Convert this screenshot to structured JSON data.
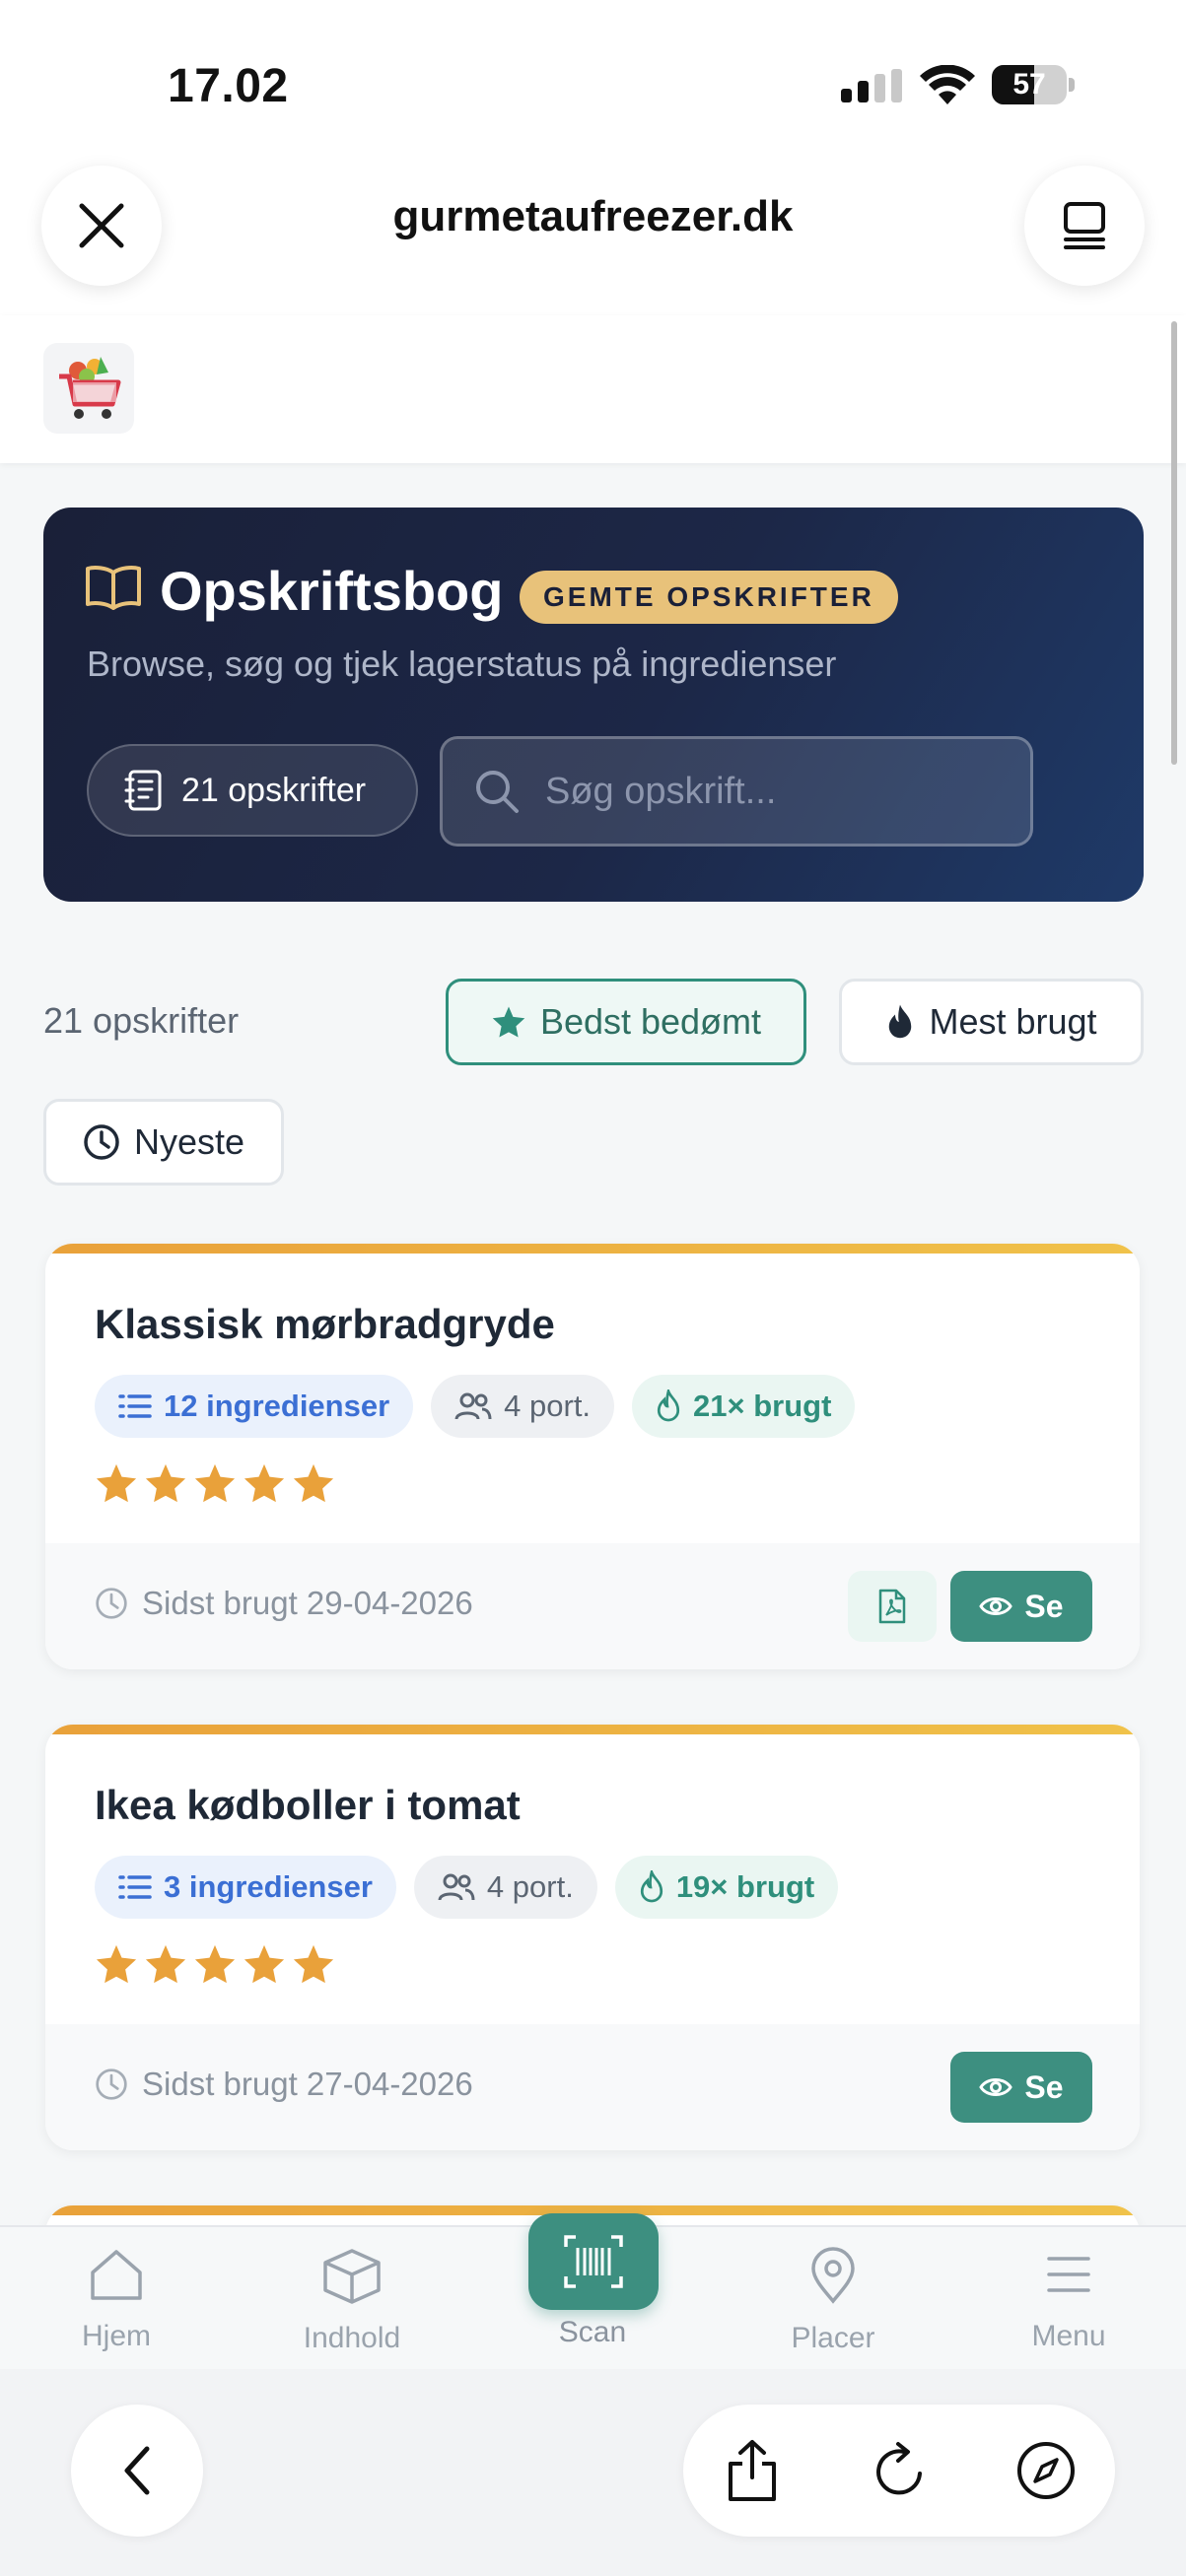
{
  "status_bar": {
    "time": "17.02",
    "battery": "57",
    "battery_level": 0.57
  },
  "browser": {
    "domain": "gurmetaufreezer.dk"
  },
  "hero": {
    "title": "Opskriftsbog",
    "badge": "GEMTE OPSKRIFTER",
    "subtitle": "Browse, søg og tjek lagerstatus på ingredienser",
    "count_label": "21 opskrifter",
    "search_placeholder": "Søg opskrift..."
  },
  "list": {
    "result_count": "21 opskrifter",
    "sort_options": [
      "Bedst bedømt",
      "Mest brugt",
      "Nyeste"
    ],
    "active_sort": "Bedst bedømt"
  },
  "recipes": [
    {
      "title": "Klassisk mørbradgryde",
      "ingredients": "12 ingredienser",
      "portions": "4 port.",
      "used": "21× brugt",
      "rating": 5,
      "last_used": "Sidst brugt 29-04-2026",
      "has_pdf": true,
      "view_label": "Se"
    },
    {
      "title": "Ikea kødboller i tomat",
      "ingredients": "3 ingredienser",
      "portions": "4 port.",
      "used": "19× brugt",
      "rating": 5,
      "last_used": "Sidst brugt 27-04-2026",
      "has_pdf": false,
      "view_label": "Se"
    }
  ],
  "app_nav": {
    "items": [
      "Hjem",
      "Indhold",
      "Scan",
      "Placer",
      "Menu"
    ]
  },
  "colors": {
    "accent": "#3d8f80",
    "hero_bg": "#1c2747",
    "badge": "#e8c27a",
    "star": "#e9a13a"
  }
}
